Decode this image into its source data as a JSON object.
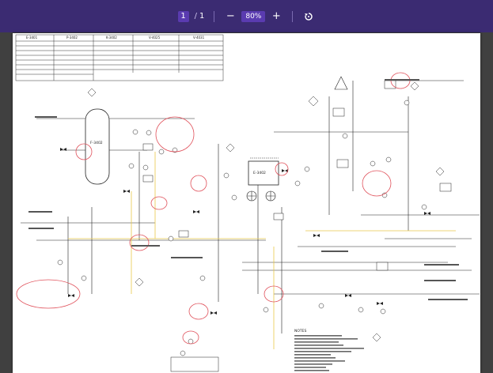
{
  "toolbar": {
    "current_page": "1",
    "total_pages": "1",
    "zoom": "80%",
    "zoom_out_symbol": "−",
    "zoom_in_symbol": "+",
    "rotate_icon": "rotate-icon",
    "bg_color": "#3b2b72",
    "accent_color": "#5a3bb0"
  },
  "drawing": {
    "equipment_tags": [
      "E-3401",
      "P-3402",
      "K-3402",
      "V-4025",
      "V-4031"
    ],
    "vessel_tag": "F-3402",
    "exchanger_tag": "E-3402",
    "notes_title": "NOTES"
  }
}
